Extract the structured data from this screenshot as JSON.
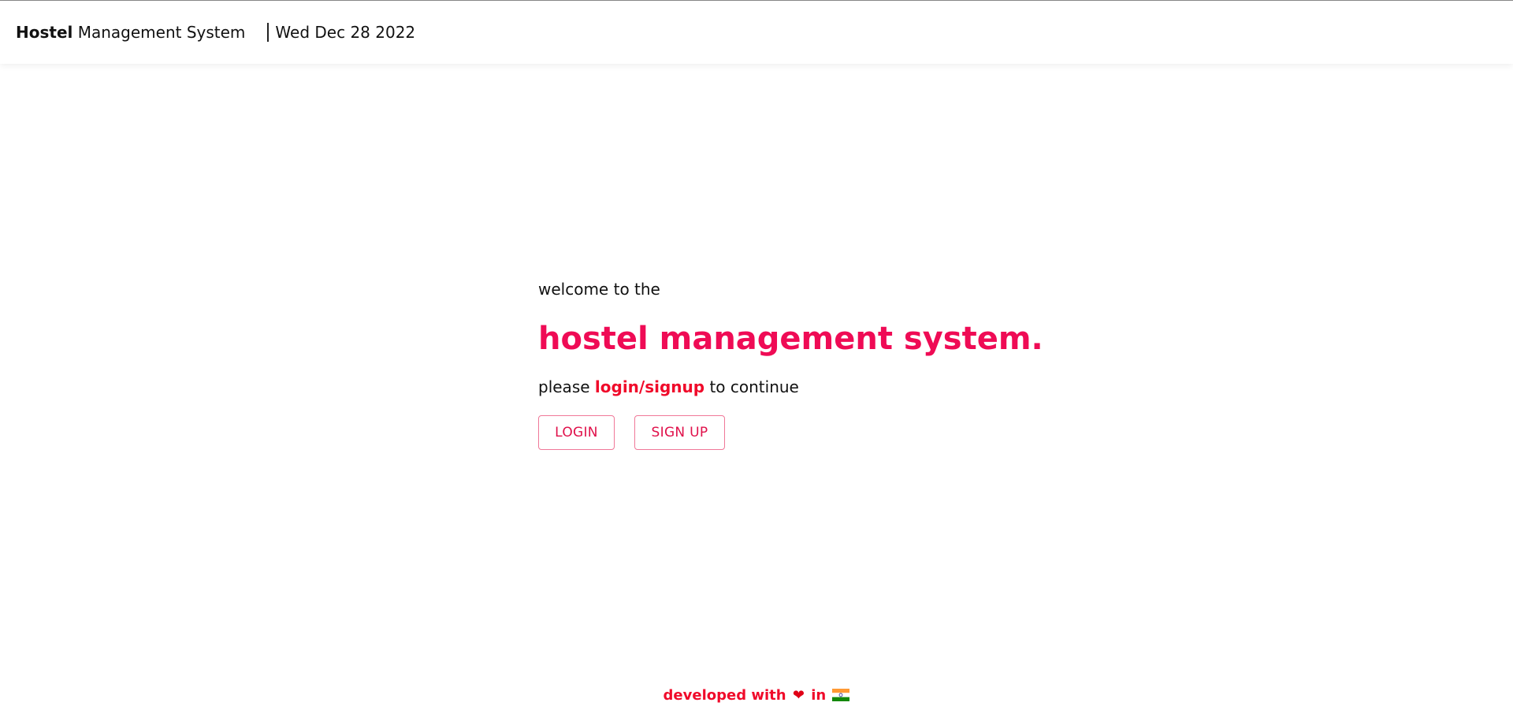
{
  "header": {
    "brand_strong": "Hostel",
    "brand_rest": " Management System",
    "date": "Wed Dec 28 2022"
  },
  "hero": {
    "welcome": "welcome to the",
    "headline": "hostel management system.",
    "prompt_before": "please ",
    "prompt_link": "login/signup",
    "prompt_after": " to continue"
  },
  "buttons": {
    "login_label": "LOGIN",
    "signup_label": "SIGN UP"
  },
  "footer": {
    "text_before": "developed with ",
    "text_in": " in ",
    "heart_icon": "heart-icon",
    "flag_icon": "india-flag-icon"
  },
  "colors": {
    "accent": "#ef0b55",
    "link": "#f00a2a",
    "button_border": "#f07898",
    "button_text": "#e0104a"
  }
}
